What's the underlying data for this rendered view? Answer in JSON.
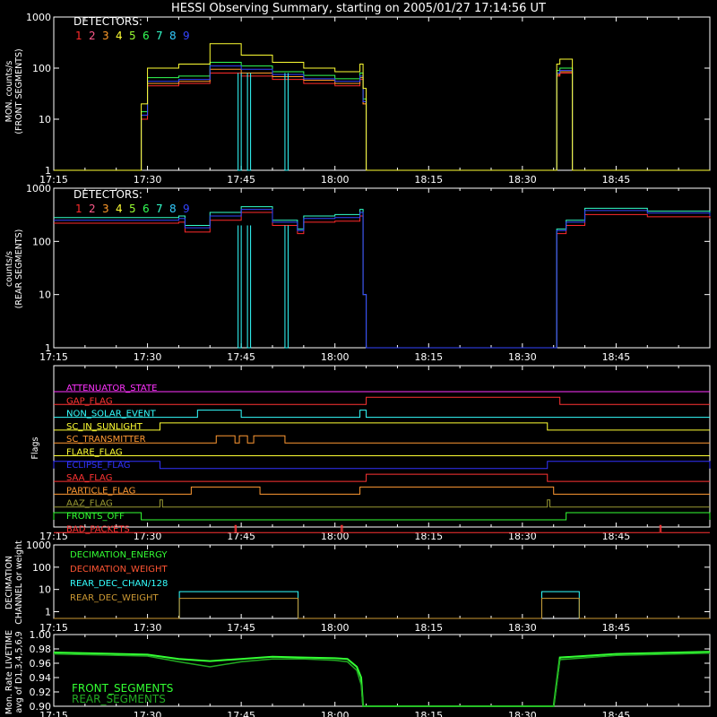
{
  "title": "HESSI Observing Summary, starting on 2005/01/27 17:14:56 UT",
  "x_axis": {
    "ticks": [
      "17:15",
      "17:30",
      "17:45",
      "18:00",
      "18:15",
      "18:30",
      "18:45"
    ],
    "range": [
      "17:15",
      "19:00"
    ]
  },
  "colors": {
    "background": "#000000",
    "axes": "#ffffff",
    "detectors": [
      "#ff2a2a",
      "#ff5a8c",
      "#ff9a2a",
      "#ffff33",
      "#99ff33",
      "#33ff55",
      "#33ffcc",
      "#33ccff",
      "#3344ff"
    ],
    "decimation": [
      "#33ff33",
      "#ff5533",
      "#33ffff",
      "#cc9933"
    ],
    "livetime": [
      "#33ff33",
      "#22aa22"
    ]
  },
  "panels": {
    "front": {
      "ylabel_lines": [
        "MON. counts/s",
        "(FRONT SEGMENTS)"
      ],
      "yticks": [
        "1",
        "10",
        "100",
        "1000"
      ],
      "legend_title": "DETECTORS:",
      "detector_numbers": [
        "1",
        "2",
        "3",
        "4",
        "5",
        "6",
        "7",
        "8",
        "9"
      ]
    },
    "rear": {
      "ylabel_lines": [
        "counts/s",
        "(REAR SEGMENTS)"
      ],
      "yticks": [
        "1",
        "10",
        "100",
        "1000"
      ],
      "legend_title": "DETECTORS:",
      "detector_numbers": [
        "1",
        "2",
        "3",
        "4",
        "5",
        "6",
        "7",
        "8",
        "9"
      ]
    },
    "flags": {
      "ylabel": "Flags",
      "items": [
        {
          "label": "ATTENUATOR_STATE",
          "color": "#ff33ff",
          "segments": []
        },
        {
          "label": "GAP_FLAG",
          "color": "#ff3333",
          "segments": [
            [
              "18:05",
              "18:36"
            ]
          ]
        },
        {
          "label": "NON_SOLAR_EVENT",
          "color": "#33ffff",
          "segments": [
            [
              "17:38",
              "17:45"
            ],
            [
              "18:04",
              "18:05"
            ]
          ]
        },
        {
          "label": "SC_IN_SUNLIGHT",
          "color": "#ffff33",
          "segments": [
            [
              "17:32",
              "18:34"
            ]
          ]
        },
        {
          "label": "SC_TRANSMITTER",
          "color": "#ff9933",
          "segments": [
            [
              "17:41",
              "17:44"
            ],
            [
              "17:44.7",
              "17:46"
            ],
            [
              "17:47",
              "17:52"
            ]
          ]
        },
        {
          "label": "FLARE_FLAG",
          "color": "#ffff33",
          "segments": []
        },
        {
          "label": "ECLIPSE_FLAG",
          "color": "#3333ff",
          "segments": [
            [
              "17:15",
              "17:32"
            ],
            [
              "18:34",
              "19:00"
            ]
          ]
        },
        {
          "label": "SAA_FLAG",
          "color": "#ff3333",
          "segments": [
            [
              "18:05",
              "18:34"
            ]
          ]
        },
        {
          "label": "PARTICLE_FLAG",
          "color": "#ff9933",
          "segments": [
            [
              "17:37",
              "17:48"
            ],
            [
              "18:04",
              "18:35"
            ]
          ]
        },
        {
          "label": "AAZ_FLAG",
          "color": "#999933",
          "segments": [
            [
              "17:32",
              "17:32.4"
            ],
            [
              "18:34",
              "18:34.4"
            ]
          ]
        },
        {
          "label": "FRONTS_OFF",
          "color": "#33ff33",
          "segments": [
            [
              "17:15",
              "17:29"
            ],
            [
              "18:37",
              "19:00"
            ]
          ]
        },
        {
          "label": "BAD_PACKETS",
          "color": "#ff3333",
          "segments": [
            [
              "17:44",
              "17:44.2"
            ],
            [
              "18:01",
              "18:01.2"
            ],
            [
              "18:52",
              "18:52.2"
            ]
          ]
        }
      ]
    },
    "decimation": {
      "ylabel_lines": [
        "DECIMATION",
        "CHANNEL or weight"
      ],
      "yticks": [
        "1",
        "10",
        "100",
        "1000"
      ],
      "legend": [
        "DECIMATION_ENERGY",
        "DECIMATION_WEIGHT",
        "REAR_DEC_CHAN/128",
        "REAR_DEC_WEIGHT"
      ]
    },
    "livetime": {
      "ylabel_lines": [
        "Mon. Rate LIVETIME",
        "avg of D1,3,4,5,6,9"
      ],
      "yticks": [
        "0.90",
        "0.92",
        "0.94",
        "0.96",
        "0.98",
        "1.00"
      ],
      "legend": [
        "FRONT_SEGMENTS",
        "REAR_SEGMENTS"
      ]
    }
  },
  "chart_data": [
    {
      "type": "line",
      "title": "HESSI Observing Summary, starting on 2005/01/27 17:14:56 UT",
      "ylabel": "MON. counts/s (FRONT SEGMENTS)",
      "yscale": "log",
      "ylim": [
        1,
        1000
      ],
      "x": [
        "17:15",
        "17:28.5",
        "17:29",
        "17:30",
        "17:35",
        "17:40",
        "17:45",
        "17:50",
        "17:55",
        "18:00",
        "18:04",
        "18:04.5",
        "18:05",
        "18:35",
        "18:35.5",
        "18:36",
        "18:37.5",
        "18:38",
        "19:00"
      ],
      "series": [
        {
          "name": "1",
          "values": [
            1,
            1,
            10,
            45,
            50,
            80,
            70,
            60,
            50,
            45,
            60,
            20,
            1,
            1,
            70,
            80,
            80,
            1,
            1
          ]
        },
        {
          "name": "3",
          "values": [
            1,
            1,
            12,
            50,
            55,
            95,
            80,
            68,
            58,
            50,
            65,
            20,
            1,
            1,
            75,
            85,
            85,
            1,
            1
          ]
        },
        {
          "name": "6",
          "values": [
            1,
            1,
            14,
            65,
            70,
            130,
            110,
            85,
            72,
            62,
            80,
            25,
            1,
            1,
            90,
            100,
            100,
            1,
            1
          ]
        },
        {
          "name": "9",
          "values": [
            1,
            1,
            12,
            55,
            60,
            110,
            95,
            75,
            62,
            55,
            70,
            22,
            1,
            1,
            80,
            90,
            90,
            1,
            1
          ]
        },
        {
          "name": "4",
          "values": [
            1,
            1,
            20,
            100,
            120,
            300,
            180,
            130,
            100,
            85,
            120,
            40,
            1,
            1,
            120,
            150,
            150,
            1,
            1
          ]
        }
      ]
    },
    {
      "type": "line",
      "ylabel": "counts/s (REAR SEGMENTS)",
      "yscale": "log",
      "ylim": [
        1,
        1000
      ],
      "x": [
        "17:15",
        "17:30",
        "17:35",
        "17:36",
        "17:40",
        "17:45",
        "17:50",
        "17:54",
        "17:55",
        "18:00",
        "18:04",
        "18:04.5",
        "18:05",
        "18:35",
        "18:35.5",
        "18:37",
        "18:40",
        "18:50",
        "19:00"
      ],
      "series": [
        {
          "name": "1",
          "values": [
            220,
            220,
            230,
            150,
            250,
            350,
            200,
            140,
            230,
            240,
            300,
            10,
            1,
            1,
            140,
            200,
            320,
            290,
            270
          ]
        },
        {
          "name": "6",
          "values": [
            280,
            280,
            300,
            200,
            350,
            450,
            250,
            170,
            300,
            320,
            400,
            10,
            1,
            1,
            170,
            250,
            420,
            370,
            330
          ]
        },
        {
          "name": "9",
          "values": [
            250,
            250,
            270,
            180,
            300,
            400,
            230,
            160,
            270,
            280,
            350,
            10,
            1,
            1,
            160,
            230,
            380,
            340,
            300
          ]
        }
      ]
    },
    {
      "type": "line",
      "ylabel": "DECIMATION CHANNEL or weight",
      "yscale": "log",
      "ylim": [
        0.5,
        1000
      ],
      "x": [
        "17:15",
        "17:35",
        "17:35.1",
        "17:54",
        "17:54.1",
        "18:33",
        "18:33.1",
        "18:39",
        "18:39.1",
        "19:00"
      ],
      "series": [
        {
          "name": "REAR_DEC_CHAN/128",
          "values": [
            0.5,
            0.5,
            8,
            8,
            0.5,
            0.5,
            8,
            8,
            0.5,
            0.5
          ]
        },
        {
          "name": "REAR_DEC_WEIGHT",
          "values": [
            0.5,
            0.5,
            4,
            4,
            0.5,
            0.5,
            4,
            4,
            0.5,
            0.5
          ]
        }
      ]
    },
    {
      "type": "line",
      "ylabel": "Mon. Rate LIVETIME avg of D1,3,4,5,6,9",
      "ylim": [
        0.9,
        1.0
      ],
      "x": [
        "17:15",
        "17:30",
        "17:35",
        "17:40",
        "17:45",
        "17:50",
        "17:55",
        "18:00",
        "18:02",
        "18:03.5",
        "18:04.2",
        "18:04.5",
        "18:35",
        "18:36",
        "18:45",
        "19:00"
      ],
      "series": [
        {
          "name": "FRONT_SEGMENTS",
          "values": [
            0.975,
            0.972,
            0.966,
            0.963,
            0.966,
            0.969,
            0.968,
            0.967,
            0.966,
            0.955,
            0.94,
            0.9,
            0.9,
            0.968,
            0.973,
            0.976
          ]
        },
        {
          "name": "REAR_SEGMENTS",
          "values": [
            0.973,
            0.97,
            0.962,
            0.955,
            0.962,
            0.966,
            0.966,
            0.964,
            0.962,
            0.95,
            0.93,
            0.9,
            0.9,
            0.965,
            0.971,
            0.974
          ]
        }
      ]
    }
  ]
}
